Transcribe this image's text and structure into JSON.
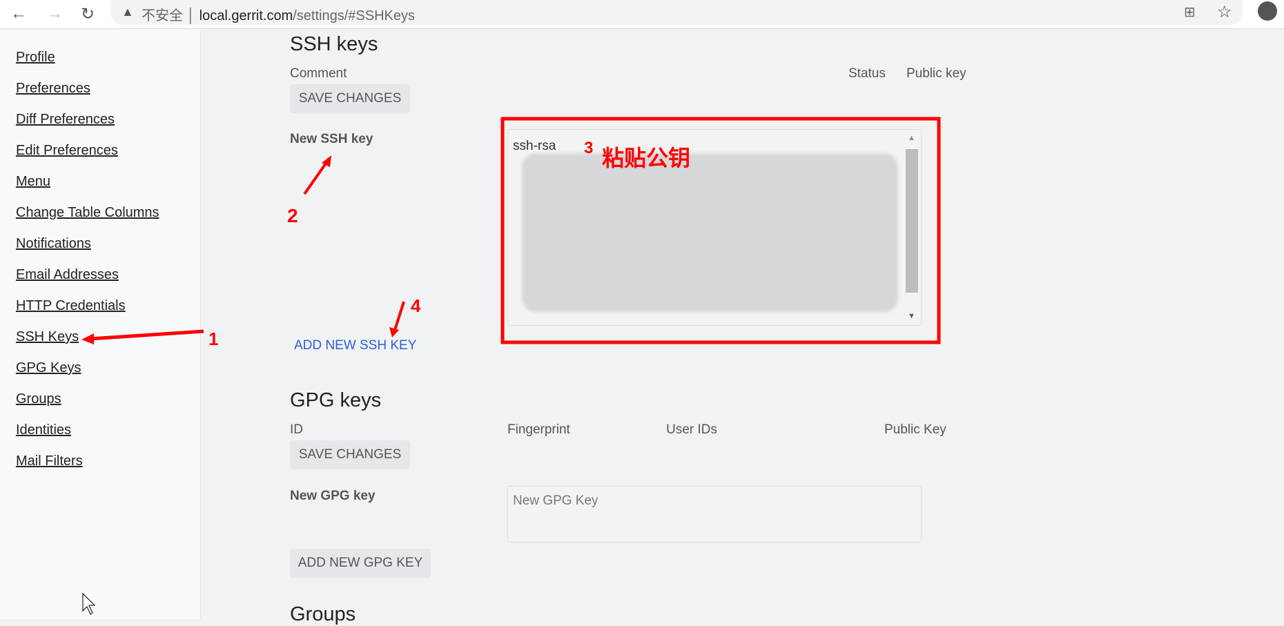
{
  "browser": {
    "security_label": "不安全",
    "url_host": "local.gerrit.com",
    "url_path": "/settings/#SSHKeys"
  },
  "sidebar": {
    "items": [
      {
        "label": "Profile"
      },
      {
        "label": "Preferences"
      },
      {
        "label": "Diff Preferences"
      },
      {
        "label": "Edit Preferences"
      },
      {
        "label": "Menu"
      },
      {
        "label": "Change Table Columns"
      },
      {
        "label": "Notifications"
      },
      {
        "label": "Email Addresses"
      },
      {
        "label": "HTTP Credentials"
      },
      {
        "label": "SSH Keys"
      },
      {
        "label": "GPG Keys"
      },
      {
        "label": "Groups"
      },
      {
        "label": "Identities"
      },
      {
        "label": "Mail Filters"
      }
    ]
  },
  "ssh": {
    "title": "SSH keys",
    "columns": [
      "Comment",
      "Status",
      "Public key"
    ],
    "save_label": "SAVE CHANGES",
    "new_label": "New SSH key",
    "textarea_value": "ssh-rsa",
    "add_label": "ADD NEW SSH KEY"
  },
  "gpg": {
    "title": "GPG keys",
    "columns": [
      "ID",
      "Fingerprint",
      "User IDs",
      "Public Key"
    ],
    "save_label": "SAVE CHANGES",
    "new_label": "New GPG key",
    "placeholder": "New GPG Key",
    "add_label": "ADD NEW GPG KEY"
  },
  "groups": {
    "title": "Groups"
  },
  "annotations": {
    "n1": "1",
    "n2": "2",
    "n3": "3",
    "n4": "4",
    "paste_text": "粘贴公钥",
    "color": "#ff0000"
  }
}
